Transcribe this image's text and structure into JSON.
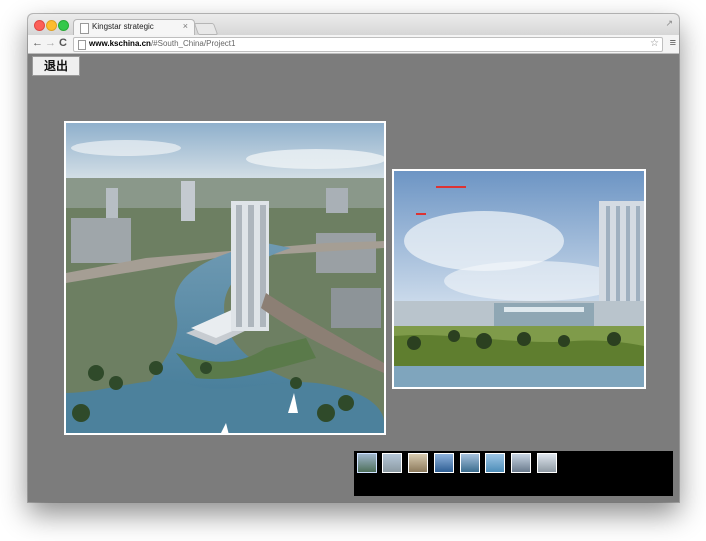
{
  "browser": {
    "tab_title": "Kingstar strategic",
    "tab_close": "×",
    "url_host": "www.kschina.cn",
    "url_path": "/#South_China/Project1",
    "expand_icon": "↗",
    "back_icon": "←",
    "forward_icon": "→",
    "reload_icon": "C",
    "star_icon": "☆",
    "menu_icon": "≡"
  },
  "page": {
    "exit_label": "退出"
  },
  "images": [
    {
      "name": "waterfront-aerial-rendering"
    },
    {
      "name": "exhibition-center-rendering"
    }
  ],
  "thumbnails": [
    {
      "name": "thumb-1",
      "selected": true
    },
    {
      "name": "thumb-2"
    },
    {
      "name": "thumb-3"
    },
    {
      "name": "thumb-4"
    },
    {
      "name": "thumb-5"
    },
    {
      "name": "thumb-6"
    },
    {
      "name": "thumb-7"
    },
    {
      "name": "thumb-8"
    }
  ],
  "colors": {
    "page_bg": "#7c7c7c",
    "thumbstrip_bg": "#000000",
    "close": "#fc5f57",
    "minimize": "#fdbc2e",
    "maximize": "#34c84a"
  }
}
